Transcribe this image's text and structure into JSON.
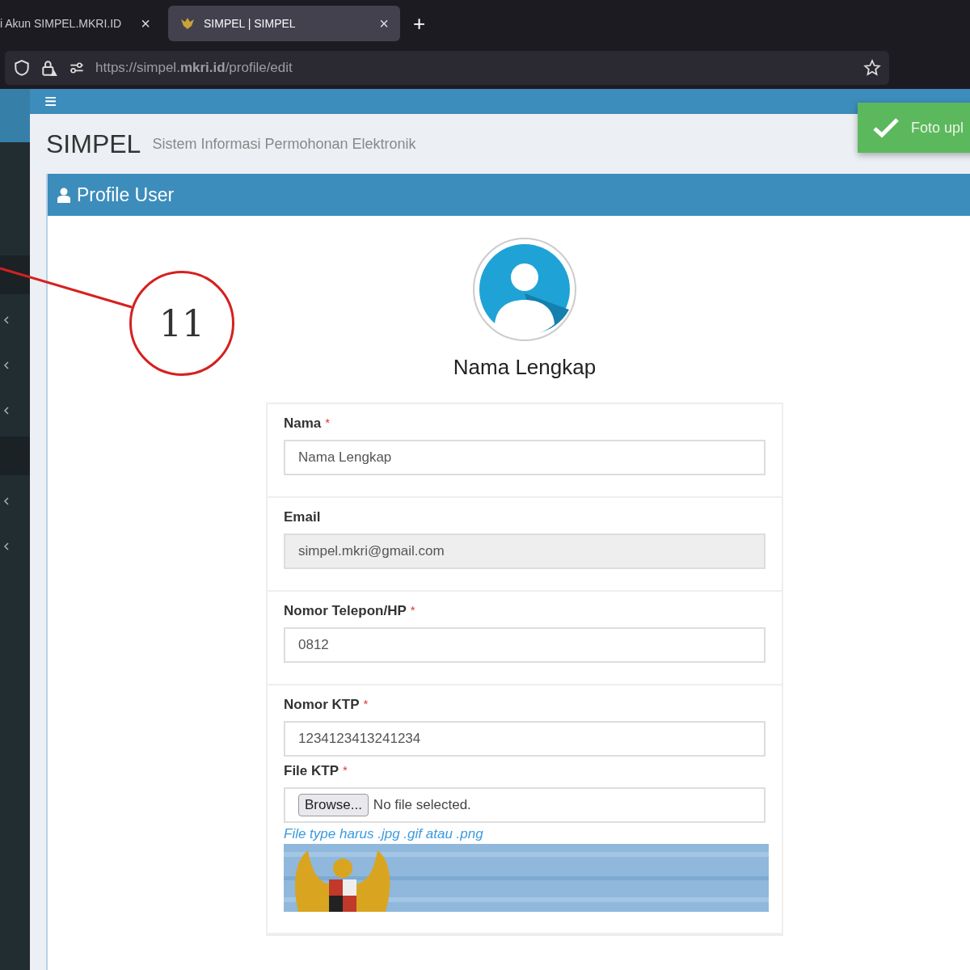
{
  "browser": {
    "tabs": [
      {
        "title": "i Akun SIMPEL.MKRI.ID",
        "close": "×",
        "selected": false
      },
      {
        "title": "SIMPEL | SIMPEL",
        "close": "×",
        "selected": true
      }
    ],
    "new_tab": "+",
    "url": "https://simpel.**mkri.id**/profile/edit"
  },
  "sidebar": {
    "items": [
      {
        "expandable": false,
        "selected": true
      },
      {
        "expandable": true,
        "selected": false
      },
      {
        "expandable": true,
        "selected": false
      },
      {
        "expandable": true,
        "selected": false
      },
      {
        "expandable": false,
        "selected": true
      },
      {
        "expandable": true,
        "selected": false
      },
      {
        "expandable": true,
        "selected": false
      }
    ]
  },
  "header": {
    "menu": "≡"
  },
  "toast": {
    "text": "Foto upl"
  },
  "page": {
    "title": "SIMPEL",
    "subtitle": "Sistem Informasi Permohonan Elektronik"
  },
  "profile_box": {
    "title": "Profile User",
    "name": "Nama Lengkap",
    "sections": [
      {
        "fields": [
          {
            "kind": "text",
            "label": "Nama",
            "required_mark": "*",
            "value": "Nama Lengkap"
          }
        ]
      },
      {
        "fields": [
          {
            "kind": "readonly",
            "label": "Email",
            "value": "simpel.mkri@gmail.com"
          }
        ]
      },
      {
        "fields": [
          {
            "kind": "text",
            "label": "Nomor Telepon/HP",
            "required_mark": "*",
            "value": "0812"
          }
        ]
      },
      {
        "fields": [
          {
            "kind": "text",
            "label": "Nomor KTP",
            "required_mark": "*",
            "value": "1234123413241234"
          },
          {
            "kind": "file",
            "label": "File KTP",
            "required_mark": "*",
            "button": "Browse...",
            "status": "No file selected.",
            "hint": "File type harus .jpg .gif atau .png"
          }
        ]
      }
    ]
  },
  "annotation": {
    "number": "11"
  }
}
